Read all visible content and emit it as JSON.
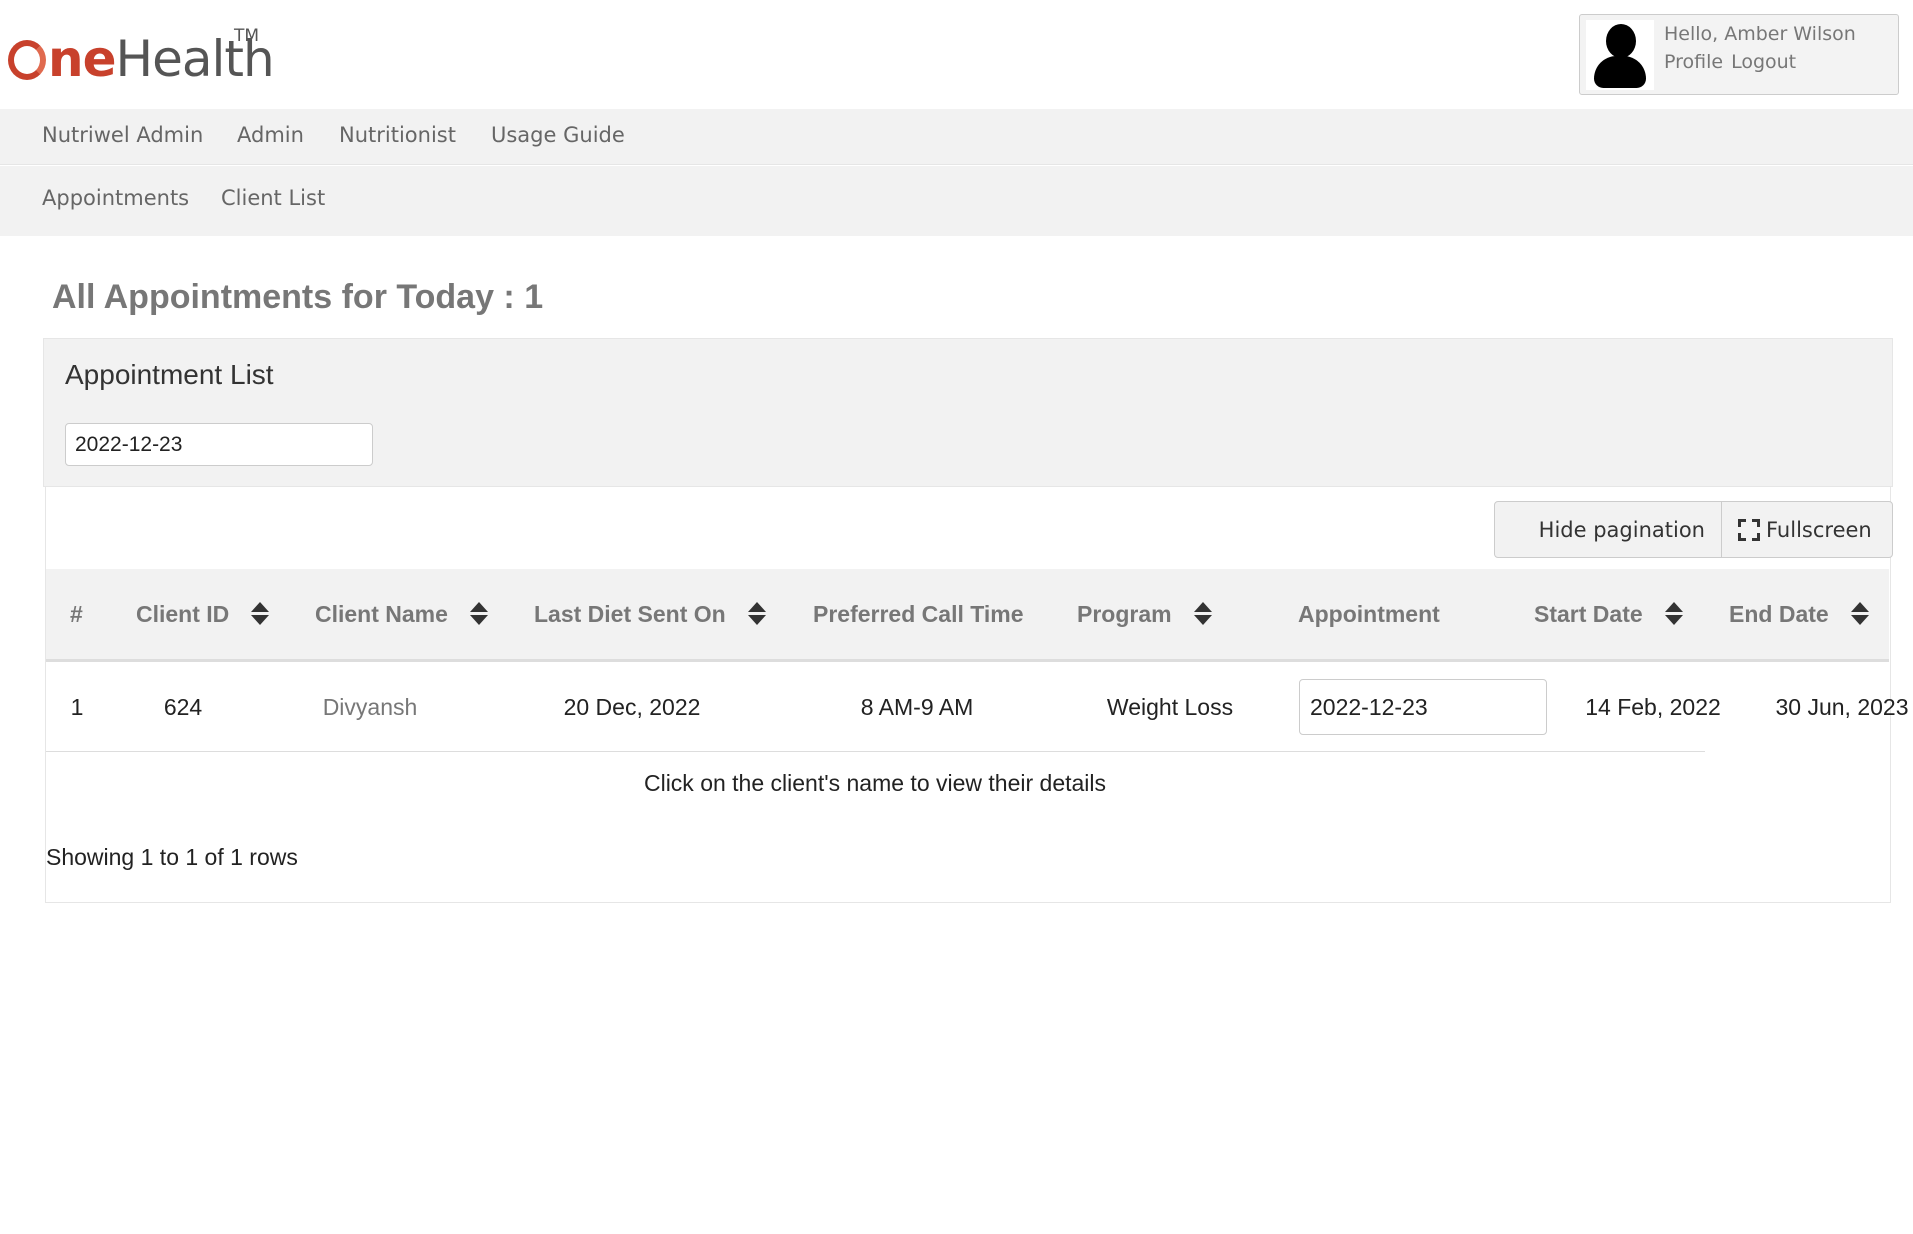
{
  "brand": {
    "one": "ne",
    "health": "Health",
    "tm": "TM"
  },
  "user": {
    "greeting": "Hello,",
    "name": "Amber Wilson",
    "profile": "Profile",
    "logout": "Logout"
  },
  "nav_primary": [
    "Nutriwel Admin",
    "Admin",
    "Nutritionist",
    "Usage Guide"
  ],
  "nav_secondary": [
    "Appointments",
    "Client List"
  ],
  "page_title": "All Appointments for Today : 1",
  "panel": {
    "title": "Appointment List",
    "date_filter": "2022-12-23"
  },
  "toolbar": {
    "hide_pagination": "Hide pagination",
    "fullscreen": "Fullscreen"
  },
  "table": {
    "columns": [
      "#",
      "Client ID",
      "Client Name",
      "Last Diet Sent On",
      "Preferred Call Time",
      "Program",
      "Appointment",
      "Start Date",
      "End Date"
    ],
    "rows": [
      {
        "num": "1",
        "client_id": "624",
        "client_name": "Divyansh",
        "last_diet": "20 Dec, 2022",
        "call_time": "8 AM-9 AM",
        "program": "Weight Loss",
        "appointment": "2022-12-23",
        "start": "14 Feb, 2022",
        "end": "30 Jun, 2023"
      }
    ]
  },
  "hint": "Click on the client's name to view their details",
  "showing": "Showing 1 to 1 of 1 rows"
}
